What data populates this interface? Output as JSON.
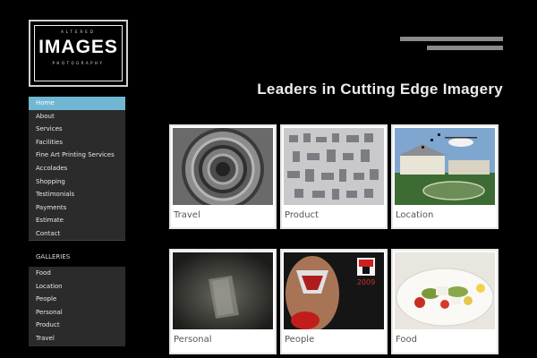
{
  "logo": {
    "top": "ALTERED",
    "main": "IMAGES",
    "bottom": "PHOTOGRAPHY"
  },
  "nav": {
    "items": [
      {
        "label": "Home",
        "active": true
      },
      {
        "label": "About"
      },
      {
        "label": "Services"
      },
      {
        "label": "Facilities"
      },
      {
        "label": "Fine Art Printing Services"
      },
      {
        "label": "Accolades"
      },
      {
        "label": "Shopping"
      },
      {
        "label": "Testimonials"
      },
      {
        "label": "Payments"
      },
      {
        "label": "Estimate"
      },
      {
        "label": "Contact"
      }
    ]
  },
  "galleries": {
    "heading": "GALLERIES",
    "items": [
      {
        "label": "Food"
      },
      {
        "label": "Location"
      },
      {
        "label": "People"
      },
      {
        "label": "Personal"
      },
      {
        "label": "Product"
      },
      {
        "label": "Travel"
      }
    ]
  },
  "header": {
    "tagline": "Leaders in Cutting Edge Imagery"
  },
  "tiles": [
    {
      "label": "Travel"
    },
    {
      "label": "Product"
    },
    {
      "label": "Location"
    },
    {
      "label": "Personal"
    },
    {
      "label": "People"
    },
    {
      "label": "Food"
    }
  ],
  "people_photo": {
    "year": "2009"
  },
  "colors": {
    "background": "#000000",
    "nav_bg": "#2b2b2b",
    "nav_active": "#6fb7d3",
    "tile_bg": "#ffffff"
  }
}
